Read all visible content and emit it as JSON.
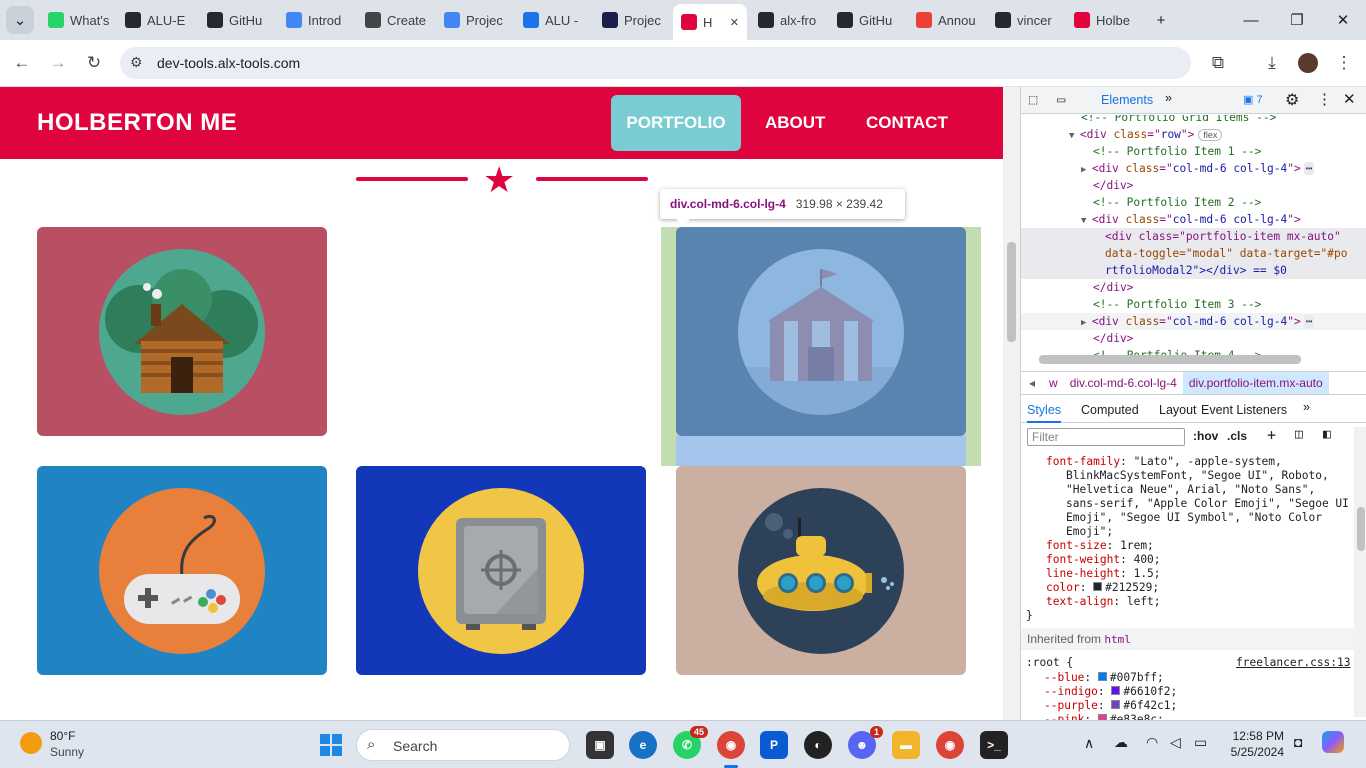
{
  "browser": {
    "tabs": [
      {
        "title": "What's",
        "icon": "whatsapp-icon",
        "color": "#25d366"
      },
      {
        "title": "ALU-E",
        "icon": "github-icon",
        "color": "#24292f"
      },
      {
        "title": "GitHu",
        "icon": "github-icon",
        "color": "#24292f"
      },
      {
        "title": "Introd",
        "icon": "docs-icon",
        "color": "#4285f4"
      },
      {
        "title": "Create",
        "icon": "chatgpt-icon",
        "color": "#444"
      },
      {
        "title": "Projec",
        "icon": "docs-icon",
        "color": "#4285f4"
      },
      {
        "title": "ALU -",
        "icon": "calendar-icon",
        "color": "#1a73e8"
      },
      {
        "title": "Projec",
        "icon": "alx-icon",
        "color": "#1d1f4a"
      },
      {
        "title": "H",
        "icon": "holberton-icon",
        "color": "#e0043e",
        "active": true
      },
      {
        "title": "alx-fro",
        "icon": "github-icon",
        "color": "#24292f"
      },
      {
        "title": "GitHu",
        "icon": "github-icon",
        "color": "#24292f"
      },
      {
        "title": "Annou",
        "icon": "gmail-icon",
        "color": "#ea4335"
      },
      {
        "title": "vincer",
        "icon": "github-icon",
        "color": "#24292f"
      },
      {
        "title": "Holbe",
        "icon": "holberton-icon",
        "color": "#e0043e"
      }
    ],
    "new_tab": "+",
    "url": "dev-tools.alx-tools.com"
  },
  "page": {
    "brand": "HOLBERTON ME",
    "nav": {
      "portfolio": "PORTFOLIO",
      "about": "ABOUT",
      "contact": "CONTACT"
    },
    "tooltip": {
      "selector": "div.col-md-6.col-lg-4",
      "size": "319.98 × 239.42"
    },
    "portfolio_items": [
      {
        "name": "cabin",
        "bg": "#b94f63",
        "circle": "#4ea890"
      },
      {
        "name": "circus",
        "bg": "#4e7198",
        "circle": "#9ebfe2"
      },
      {
        "name": "game-controller",
        "bg": "#1f83c4",
        "circle": "#e87f3a"
      },
      {
        "name": "safe",
        "bg": "#1237b8",
        "circle": "#f1c646"
      },
      {
        "name": "submarine",
        "bg": "#cbb0a1",
        "circle": "#2d4258"
      }
    ]
  },
  "devtools": {
    "tabs": {
      "elements": "Elements",
      "issues_count": "7"
    },
    "dom": [
      {
        "indent": 5,
        "text": "<!-- Portfolio Grid Items -->",
        "kind": "cmt"
      },
      {
        "indent": 4,
        "arrow": "▼",
        "tag": "div",
        "attr": "class",
        "val": "row",
        "badge": "flex"
      },
      {
        "indent": 6,
        "text": "<!-- Portfolio Item 1 -->",
        "kind": "cmt"
      },
      {
        "indent": 5,
        "arrow": "▶",
        "tag": "div",
        "attr": "class",
        "val": "col-md-6 col-lg-4",
        "ellipsis": true
      },
      {
        "indent": 6,
        "text": "</div>",
        "kind": "tag"
      },
      {
        "indent": 6,
        "text": "<!-- Portfolio Item 2 -->",
        "kind": "cmt"
      },
      {
        "indent": 5,
        "arrow": "▼",
        "tag": "div",
        "attr": "class",
        "val": "col-md-6 col-lg-4"
      },
      {
        "indent": 7,
        "text": "<div class=\"portfolio-item mx-auto\"",
        "kind": "tag",
        "hl": true
      },
      {
        "indent": 7,
        "text": "data-toggle=\"modal\" data-target=\"#po",
        "kind": "attr",
        "hl": true
      },
      {
        "indent": 7,
        "text": "rtfolioModal2\"></div> == $0",
        "kind": "val",
        "hl": true
      },
      {
        "indent": 6,
        "text": "</div>",
        "kind": "tag"
      },
      {
        "indent": 6,
        "text": "<!-- Portfolio Item 3 -->",
        "kind": "cmt"
      },
      {
        "indent": 5,
        "arrow": "▶",
        "tag": "div",
        "attr": "class",
        "val": "col-md-6 col-lg-4",
        "ellipsis": true,
        "hover": true
      },
      {
        "indent": 6,
        "text": "</div>",
        "kind": "tag"
      },
      {
        "indent": 6,
        "text": "<!-- Portfolio Item 4 -->",
        "kind": "cmt"
      }
    ],
    "breadcrumb": [
      "w",
      "div.col-md-6.col-lg-4",
      "div.portfolio-item.mx-auto"
    ],
    "style_tabs": [
      "Styles",
      "Computed",
      "Layout",
      "Event Listeners"
    ],
    "filter_placeholder": "Filter",
    "hov": ":hov",
    "cls": ".cls",
    "styles": [
      {
        "indent": 2,
        "prop": "font-family",
        "value": "\"Lato\", -apple-system,"
      },
      {
        "indent": 4,
        "prop": "",
        "value": "BlinkMacSystemFont, \"Segoe UI\", Roboto,"
      },
      {
        "indent": 4,
        "prop": "",
        "value": "\"Helvetica Neue\", Arial, \"Noto Sans\","
      },
      {
        "indent": 4,
        "prop": "",
        "value": "sans-serif, \"Apple Color Emoji\", \"Segoe UI"
      },
      {
        "indent": 4,
        "prop": "",
        "value": "Emoji\", \"Segoe UI Symbol\", \"Noto Color"
      },
      {
        "indent": 4,
        "prop": "",
        "value": "Emoji\";"
      },
      {
        "indent": 2,
        "prop": "font-size",
        "value": "1rem;"
      },
      {
        "indent": 2,
        "prop": "font-weight",
        "value": "400;"
      },
      {
        "indent": 2,
        "prop": "line-height",
        "value": "1.5;"
      },
      {
        "indent": 2,
        "prop": "color",
        "value": "#212529;",
        "swatch": "#212529"
      },
      {
        "indent": 2,
        "prop": "text-align",
        "value": "left;"
      },
      {
        "indent": 0,
        "prop": "",
        "value": "}"
      }
    ],
    "inherited_label": "Inherited from",
    "inherited_tag": "html",
    "root_selector": ":root {",
    "root_source": "freelancer.css:13",
    "root_vars": [
      {
        "prop": "--blue",
        "value": "#007bff;",
        "swatch": "#007bff"
      },
      {
        "prop": "--indigo",
        "value": "#6610f2;",
        "swatch": "#6610f2"
      },
      {
        "prop": "--purple",
        "value": "#6f42c1;",
        "swatch": "#6f42c1"
      },
      {
        "prop": "--pink",
        "value": "#e83e8c;",
        "swatch": "#e83e8c"
      }
    ]
  },
  "taskbar": {
    "weather_temp": "80°F",
    "weather_desc": "Sunny",
    "search_placeholder": "Search",
    "whatsapp_badge": "45",
    "discord_badge": "1",
    "time": "12:58 PM",
    "date": "5/25/2024"
  }
}
